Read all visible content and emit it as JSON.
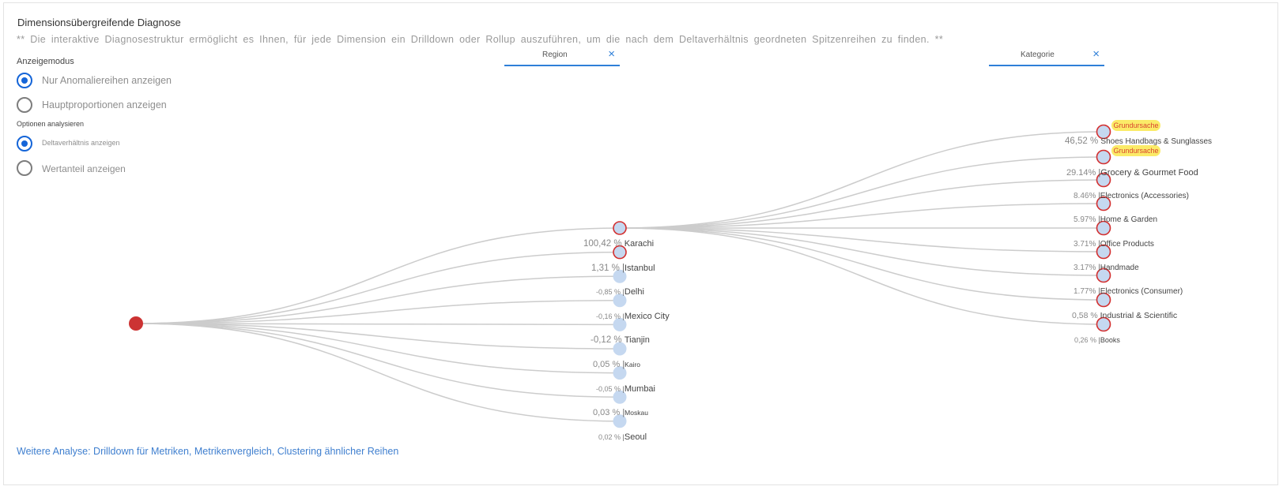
{
  "header": {
    "title": "Dimensionsübergreifende Diagnose",
    "description": "** Die interaktive Diagnosestruktur ermöglicht es Ihnen, für jede Dimension ein Drilldown oder Rollup auszuführen, um die nach dem Deltaverhältnis geordneten Spitzenreihen zu finden. **"
  },
  "display_mode": {
    "label": "Anzeigemodus",
    "options": [
      {
        "label": "Nur Anomaliereihen anzeigen",
        "selected": true
      },
      {
        "label": "Hauptproportionen anzeigen",
        "selected": false
      }
    ]
  },
  "analysis_options": {
    "label": "Optionen analysieren",
    "options": [
      {
        "label": "Deltaverhältnis anzeigen",
        "selected": true
      },
      {
        "label": "Wertanteil anzeigen",
        "selected": false
      }
    ]
  },
  "filters": {
    "region": {
      "label": "Region",
      "close": "×"
    },
    "category": {
      "label": "Kategorie",
      "close": "×"
    }
  },
  "tree": {
    "root_color": "#cc3333",
    "node_fill": "#c5d8f0",
    "highlight_stroke": "#d32f2f",
    "link_color": "#cccccc",
    "regions": [
      {
        "pct": "100,42 %",
        "sep": "",
        "name": "Karachi",
        "highlight": true
      },
      {
        "pct": "1,31 %",
        "sep": "|",
        "name": "Istanbul",
        "highlight": true
      },
      {
        "pct": "-0,85 %",
        "sep": "|",
        "name": "Delhi",
        "highlight": false
      },
      {
        "pct": "-0,16 %",
        "sep": "|",
        "name": "Mexico City",
        "highlight": false
      },
      {
        "pct": "-0,12 %",
        "sep": "",
        "name": "Tianjin",
        "highlight": false
      },
      {
        "pct": "0,05 %",
        "sep": "|",
        "name": "Kairo",
        "highlight": false
      },
      {
        "pct": "-0,05 %",
        "sep": "|",
        "name": "Mumbai",
        "highlight": false
      },
      {
        "pct": "0,03 %",
        "sep": "|",
        "name": "Moskau",
        "highlight": false
      },
      {
        "pct": "0,02 %",
        "sep": "|",
        "name": "Seoul",
        "highlight": false
      }
    ],
    "categories": [
      {
        "pct": "46,52 %",
        "sep": "",
        "name": "Shoes Handbags & Sunglasses",
        "badge": "Grundursache"
      },
      {
        "pct": "29.14%",
        "sep": "|",
        "name": "Grocery & Gourmet Food",
        "badge": "Grundursache"
      },
      {
        "pct": "8.46%",
        "sep": "|",
        "name": "Electronics (Accessories)",
        "badge": ""
      },
      {
        "pct": "5.97%",
        "sep": "|",
        "name": "Home & Garden",
        "badge": ""
      },
      {
        "pct": "3.71%",
        "sep": "|",
        "name": "Office Products",
        "badge": ""
      },
      {
        "pct": "3.17%",
        "sep": "|",
        "name": "Handmade",
        "badge": ""
      },
      {
        "pct": "1.77%",
        "sep": "|",
        "name": "Electronics (Consumer)",
        "badge": ""
      },
      {
        "pct": "0,58 %",
        "sep": "",
        "name": "Industrial & Scientific",
        "badge": ""
      },
      {
        "pct": "0,26 %",
        "sep": "|",
        "name": "Books",
        "badge": ""
      }
    ]
  },
  "footer": {
    "link": "Weitere Analyse: Drilldown für Metriken, Metrikenvergleich, Clustering ähnlicher Reihen"
  }
}
